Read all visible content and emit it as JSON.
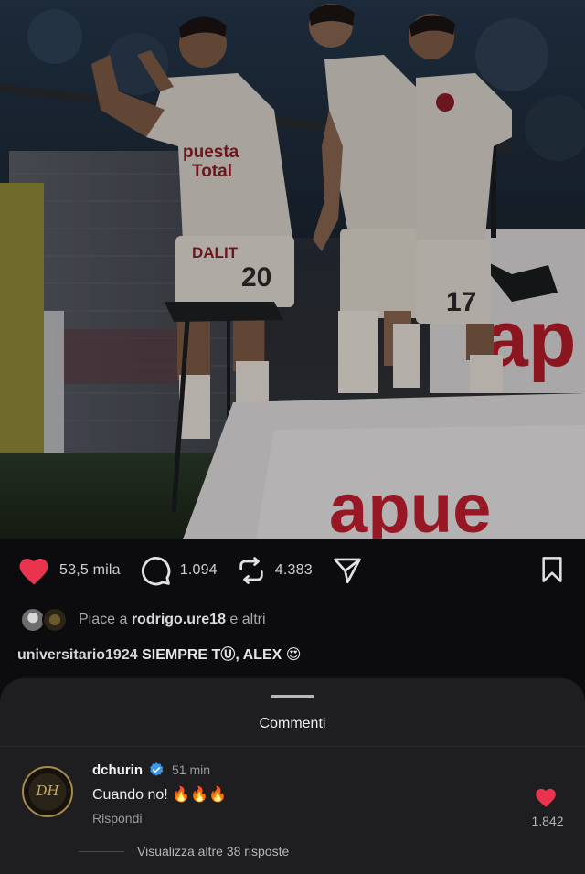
{
  "post": {
    "image_alt": "Giocatori dell'Universitario festeggiano un gol",
    "jersey_numbers": [
      "20",
      "17"
    ],
    "sponsor_text": [
      "apuesta",
      "total",
      "apue"
    ]
  },
  "actions": {
    "like_icon": "heart-icon",
    "like_count": "53,5 mila",
    "comment_icon": "comment-bubble-icon",
    "comment_count": "1.094",
    "repost_icon": "repost-icon",
    "repost_count": "4.383",
    "share_icon": "send-icon",
    "bookmark_icon": "bookmark-icon"
  },
  "likes_line": {
    "prefix": "Piace a",
    "user": "rodrigo.ure18",
    "suffix": "e altri"
  },
  "caption": {
    "user": "universitario1924",
    "text": "SIEMPRE TⓊ, ALEX 😍"
  },
  "comments_sheet": {
    "title": "Commenti",
    "comment": {
      "avatar_monogram": "DH",
      "user": "dchurin",
      "verified": true,
      "time": "51 min",
      "text": "Cuando no! 🔥🔥🔥",
      "reply_label": "Rispondi",
      "like_count": "1.842"
    },
    "more_replies_label": "Visualizza altre 38 risposte"
  },
  "colors": {
    "background": "#0c0c0e",
    "sheet": "#1e1e21",
    "like_red": "#e8344e",
    "verified_blue": "#3897f0"
  }
}
